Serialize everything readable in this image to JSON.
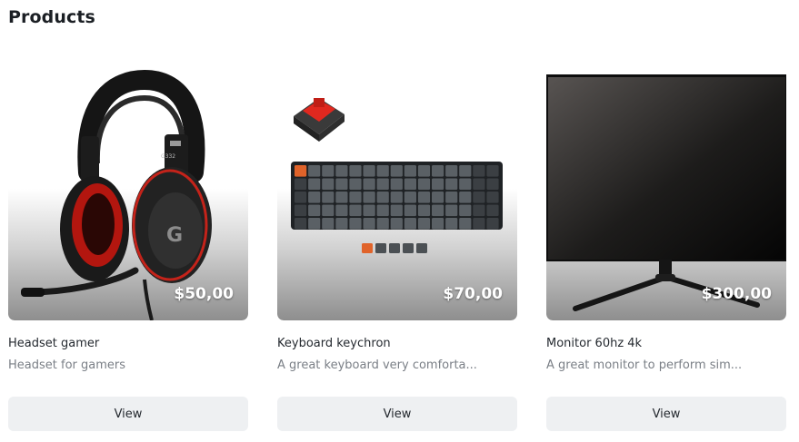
{
  "page": {
    "title": "Products"
  },
  "products": [
    {
      "name": "Headset gamer",
      "description": "Headset for gamers",
      "price": "$50,00",
      "view_label": "View",
      "image": "headset-image",
      "logo_text": "G332"
    },
    {
      "name": "Keyboard keychron",
      "description": "A great keyboard very comforta...",
      "price": "$70,00",
      "view_label": "View",
      "image": "keyboard-image"
    },
    {
      "name": "Monitor 60hz 4k",
      "description": "A great monitor to perform sim...",
      "price": "$300,00",
      "view_label": "View",
      "image": "monitor-image"
    }
  ],
  "colors": {
    "button_bg": "#eef0f2",
    "accent_red": "#e0281f",
    "keycap_orange": "#e0632a"
  }
}
